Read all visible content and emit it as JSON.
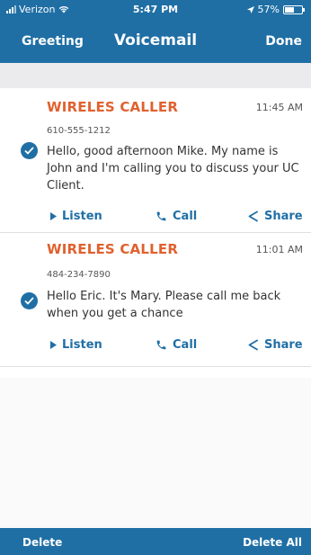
{
  "status_bar": {
    "carrier": "Verizon",
    "time": "5:47 PM",
    "battery": "57%",
    "battery_level": 0.57
  },
  "nav": {
    "left_label": "Greeting",
    "title": "Voicemail",
    "right_label": "Done"
  },
  "voicemails": [
    {
      "caller": "WIRELES CALLER",
      "time": "11:45 AM",
      "number": "610-555-1212",
      "message": "Hello, good afternoon Mike. My name is John and I'm calling you to discuss your UC Client.",
      "listen_label": "Listen",
      "call_label": "Call",
      "share_label": "Share"
    },
    {
      "caller": "WIRELES CALLER",
      "time": "11:01 AM",
      "number": "484-234-7890",
      "message": "Hello Eric. It's Mary. Please call me back when you get a chance",
      "listen_label": "Listen",
      "call_label": "Call",
      "share_label": "Share"
    }
  ],
  "footer": {
    "delete_label": "Delete",
    "delete_all_label": "Delete All"
  },
  "colors": {
    "header": "#1f6fa5",
    "caller": "#e0612f",
    "action": "#1f6fa5"
  },
  "icons": [
    "wifi-icon",
    "location-arrow-icon",
    "battery-icon",
    "check-icon",
    "play-icon",
    "phone-icon",
    "share-icon"
  ]
}
